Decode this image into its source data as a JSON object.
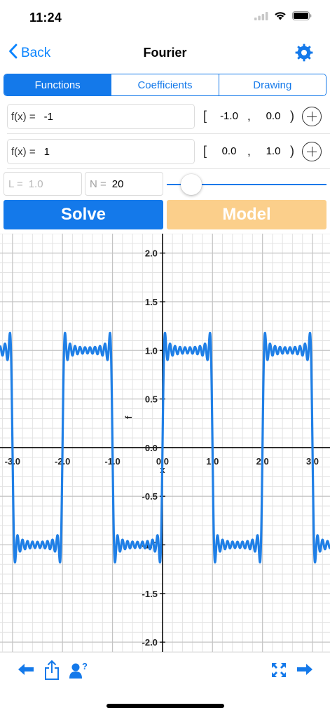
{
  "status_bar": {
    "time": "11:24"
  },
  "nav": {
    "back_label": "Back",
    "title": "Fourier"
  },
  "tabs": [
    {
      "label": "Functions",
      "active": true
    },
    {
      "label": "Coefficients",
      "active": false
    },
    {
      "label": "Drawing",
      "active": false
    }
  ],
  "functions": [
    {
      "label": "f(x) =",
      "value": "-1",
      "range_start": "-1.0",
      "range_end": "0.0"
    },
    {
      "label": "f(x) =",
      "value": "1",
      "range_start": "0.0",
      "range_end": "1.0"
    }
  ],
  "range_symbols": {
    "open": "[",
    "separator": ",",
    "close": ")"
  },
  "params": {
    "L_label": "L =",
    "L_value": "1.0",
    "N_label": "N =",
    "N_value": "20",
    "slider_fraction": 0.1
  },
  "buttons": {
    "solve": "Solve",
    "model": "Model"
  },
  "colors": {
    "accent": "#1479ea",
    "model_button": "#fbcf8b",
    "curve": "#1f7fe6",
    "minor_grid": "#e3e3e3",
    "major_grid": "#c4c4c4"
  },
  "chart_data": {
    "type": "line",
    "x_range": [
      -3.25,
      3.35
    ],
    "y_range": [
      -2.1,
      2.2
    ],
    "x_ticks": [
      "-3.0",
      "-2.0",
      "-1.0",
      "0.0",
      "1.0",
      "2.0",
      "3.0"
    ],
    "y_ticks": [
      "2.0",
      "1.5",
      "1.0",
      "0.5",
      "0.0",
      "-0.5",
      "-1.0",
      "-1.5",
      "-2.0"
    ],
    "xlabel": "x",
    "ylabel": "f",
    "grid": true,
    "function": "Fourier series of square wave (f=-1 on [-1,0), f=1 on [0,1)), period 2L with L=1.0",
    "terms_N": 20
  },
  "toolbar": {
    "left": [
      "arrow-left-icon",
      "share-icon",
      "user-help-icon"
    ],
    "right": [
      "fullscreen-icon",
      "arrow-right-icon"
    ]
  }
}
